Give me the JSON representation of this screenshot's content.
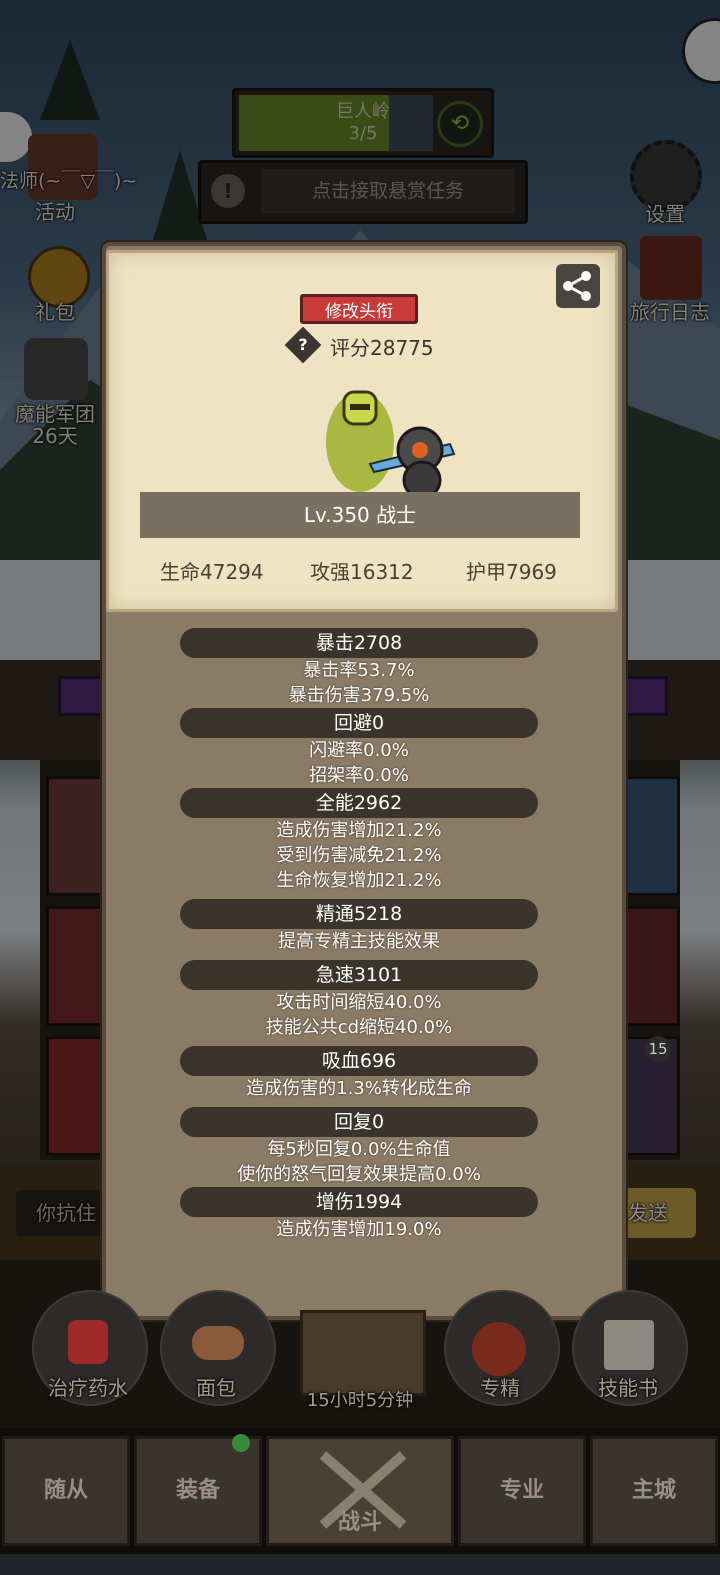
{
  "hud": {
    "region": {
      "name": "巨人岭",
      "progress": "3/5",
      "fill_fraction": 0.6
    },
    "bounty_text": "点击接取悬赏任务",
    "left_menu": [
      {
        "icon": "chest-icon",
        "label": "活动"
      },
      {
        "icon": "coin-pouch-icon",
        "label": "礼包"
      },
      {
        "icon": "wolf-crest-icon",
        "label": "魔能军团",
        "sub": "26天"
      }
    ],
    "chat_snippet": "法师",
    "chat_emote": "(~￣▽￣)~",
    "right_menu": [
      {
        "icon": "gear-icon",
        "label": "设置"
      },
      {
        "icon": "journal-icon",
        "label": "旅行日志"
      }
    ],
    "chat_input_placeholder": "你抗住",
    "send_label": "发送"
  },
  "profile": {
    "edit_title_label": "修改头衔",
    "score": "评分28775",
    "name_line": "Lv.350 战士",
    "base_stats": {
      "hp": "生命47294",
      "atk": "攻强16312",
      "armor": "护甲7969"
    }
  },
  "stat_groups": [
    {
      "title": "暴击2708",
      "lines": [
        "暴击率53.7%",
        "暴击伤害379.5%"
      ]
    },
    {
      "title": "回避0",
      "lines": [
        "闪避率0.0%",
        "招架率0.0%"
      ]
    },
    {
      "title": "全能2962",
      "lines": [
        "造成伤害增加21.2%",
        "受到伤害减免21.2%",
        "生命恢复增加21.2%"
      ]
    },
    {
      "title": "精通5218",
      "lines": [
        "提高专精主技能效果"
      ]
    },
    {
      "title": "急速3101",
      "lines": [
        "攻击时间缩短40.0%",
        "技能公共cd缩短40.0%"
      ]
    },
    {
      "title": "吸血696",
      "lines": [
        "造成伤害的1.3%转化成生命"
      ]
    },
    {
      "title": "回复0",
      "lines": [
        "每5秒回复0.0%生命值",
        "使你的怒气回复效果提高0.0%"
      ]
    },
    {
      "title": "增伤1994",
      "lines": [
        "造成伤害增加19.0%"
      ]
    }
  ],
  "bottom_items": [
    {
      "icon": "potion-icon",
      "label": "治疗药水"
    },
    {
      "icon": "bread-icon",
      "label": "面包"
    },
    {
      "icon": "treasure-chest-icon",
      "label": "15小时5分钟"
    },
    {
      "icon": "specialization-icon",
      "label": "专精"
    },
    {
      "icon": "skill-book-icon",
      "label": "技能书"
    }
  ],
  "badge_count": "15",
  "nav": [
    {
      "label": "随从"
    },
    {
      "label": "装备"
    },
    {
      "label": "战斗"
    },
    {
      "label": "专业"
    },
    {
      "label": "主城"
    }
  ],
  "colors": {
    "accent_red": "#c93a3a",
    "panel": "#8a7a66",
    "card": "#efe3c3",
    "stat_header": "#3b342c"
  }
}
